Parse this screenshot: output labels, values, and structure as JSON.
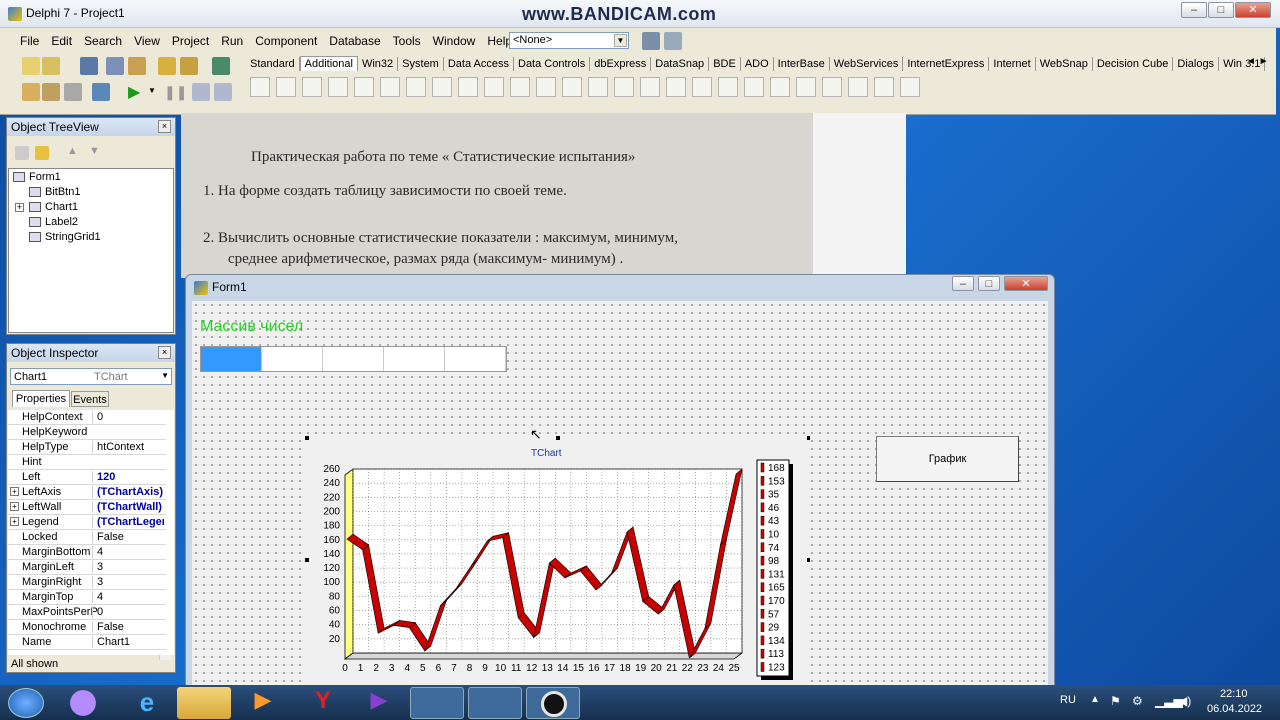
{
  "watermark": "www.BANDICAM.com",
  "ide": {
    "title": "Delphi 7 - Project1",
    "menu": [
      "File",
      "Edit",
      "Search",
      "View",
      "Project",
      "Run",
      "Component",
      "Database",
      "Tools",
      "Window",
      "Help"
    ],
    "combo_value": "<None>",
    "palette_tabs": [
      "Standard",
      "Additional",
      "Win32",
      "System",
      "Data Access",
      "Data Controls",
      "dbExpress",
      "DataSnap",
      "BDE",
      "ADO",
      "InterBase",
      "WebServices",
      "InternetExpress",
      "Internet",
      "WebSnap",
      "Decision Cube",
      "Dialogs",
      "Win 3.1"
    ],
    "active_tab": "Additional"
  },
  "tree_view": {
    "title": "Object TreeView",
    "nodes": [
      "Form1",
      "BitBtn1",
      "Chart1",
      "Label2",
      "StringGrid1"
    ]
  },
  "inspector": {
    "title": "Object Inspector",
    "object": "Chart1",
    "type": "TChart",
    "tabs": [
      "Properties",
      "Events"
    ],
    "rows": [
      {
        "name": "HelpContext",
        "value": "0"
      },
      {
        "name": "HelpKeyword",
        "value": ""
      },
      {
        "name": "HelpType",
        "value": "htContext"
      },
      {
        "name": "Hint",
        "value": ""
      },
      {
        "name": "Left",
        "value": "120"
      },
      {
        "name": "LeftAxis",
        "value": "(TChartAxis)"
      },
      {
        "name": "LeftWall",
        "value": "(TChartWall)"
      },
      {
        "name": "Legend",
        "value": "(TChartLegend)"
      },
      {
        "name": "Locked",
        "value": "False"
      },
      {
        "name": "MarginBottom",
        "value": "4"
      },
      {
        "name": "MarginLeft",
        "value": "3"
      },
      {
        "name": "MarginRight",
        "value": "3"
      },
      {
        "name": "MarginTop",
        "value": "4"
      },
      {
        "name": "MaxPointsPerP",
        "value": "0"
      },
      {
        "name": "Monochrome",
        "value": "False"
      },
      {
        "name": "Name",
        "value": "Chart1"
      }
    ],
    "status": "All shown"
  },
  "paper": {
    "line1": "Практическая работа по теме « Статистические испытания»",
    "line2": "1.  На форме создать таблицу зависимости  по своей теме.",
    "line3": "2.  Вычислить основные статистические показатели : максимум, минимум,",
    "line4": "среднее арифметическое, размах ряда (максимум- минимум) ."
  },
  "form": {
    "title": "Form1",
    "label": "Массив чисел",
    "button": "График",
    "chart_title": "TChart"
  },
  "chart_data": {
    "type": "line",
    "title": "TChart",
    "x": [
      0,
      1,
      2,
      3,
      4,
      5,
      6,
      7,
      8,
      9,
      10,
      11,
      12,
      13,
      14,
      15,
      16,
      17,
      18,
      19,
      20,
      21,
      22,
      23,
      24,
      25
    ],
    "values": [
      168,
      153,
      35,
      46,
      43,
      10,
      74,
      98,
      131,
      165,
      170,
      57,
      29,
      134,
      113,
      123,
      96,
      120,
      178,
      80,
      62,
      103,
      0,
      42,
      160,
      260
    ],
    "ylim": [
      0,
      260
    ],
    "yticks": [
      260,
      240,
      220,
      200,
      180,
      160,
      140,
      120,
      100,
      80,
      60,
      40,
      20
    ],
    "legend": [
      "168",
      "153",
      "35",
      "46",
      "43",
      "10",
      "74",
      "98",
      "131",
      "165",
      "170",
      "57",
      "29",
      "134",
      "113",
      "123"
    ],
    "legend_placement": "right",
    "series_color": "#d40000"
  },
  "taskbar": {
    "lang": "RU",
    "time": "22:10",
    "date": "06.04.2022"
  }
}
